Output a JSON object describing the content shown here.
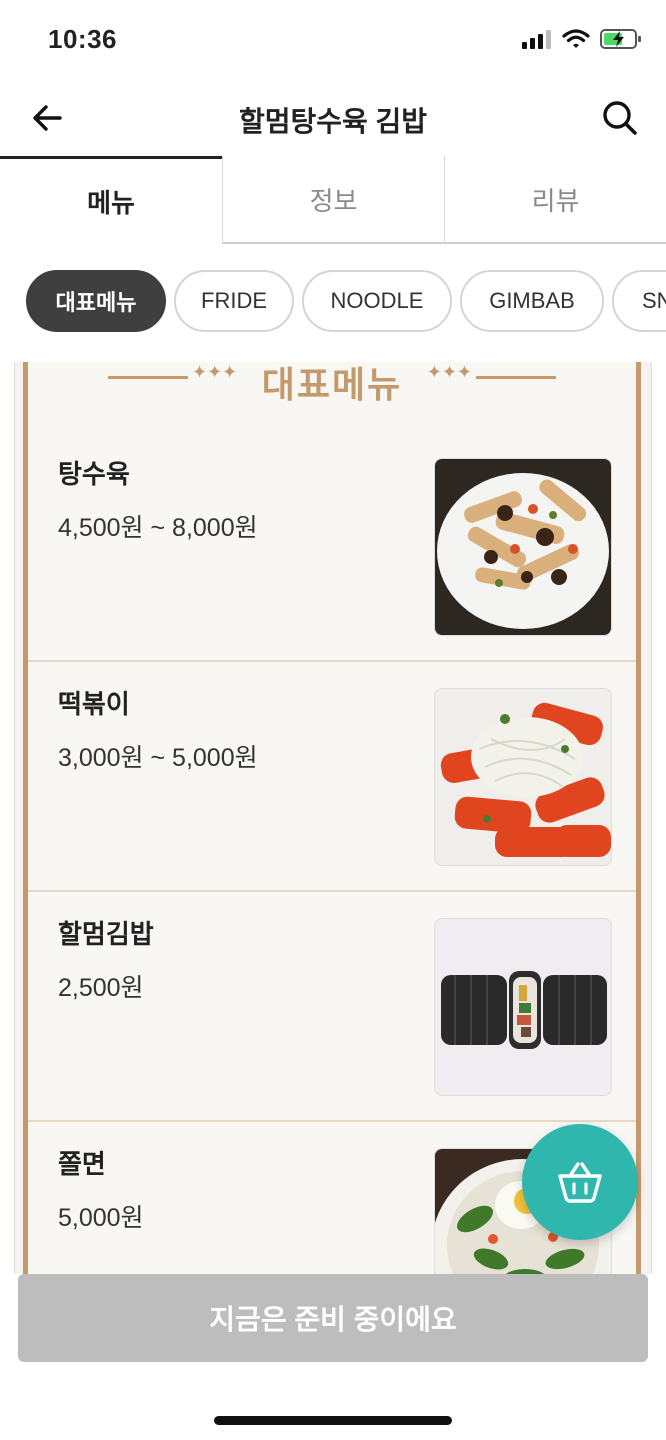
{
  "status": {
    "time": "10:36"
  },
  "header": {
    "title": "할멈탕수육 김밥"
  },
  "tabs": [
    {
      "label": "메뉴"
    },
    {
      "label": "정보"
    },
    {
      "label": "리뷰"
    }
  ],
  "categories": [
    {
      "label": "대표메뉴"
    },
    {
      "label": "FRIDE"
    },
    {
      "label": "NOODLE"
    },
    {
      "label": "GIMBAB"
    },
    {
      "label": "SNACK"
    }
  ],
  "section": {
    "title": "대표메뉴"
  },
  "menu_items": [
    {
      "name": "탕수육",
      "price": "4,500원 ~ 8,000원"
    },
    {
      "name": "떡볶이",
      "price": "3,000원 ~ 5,000원"
    },
    {
      "name": "할멈김밥",
      "price": "2,500원"
    },
    {
      "name": "쫄면",
      "price": "5,000원"
    }
  ],
  "bottom_button": {
    "label": "지금은 준비 중이에요"
  },
  "colors": {
    "accent": "#c49a6c",
    "cart": "#2fb7ae",
    "chip_selected": "#3f3f3f",
    "disabled": "#bdbdbd"
  }
}
